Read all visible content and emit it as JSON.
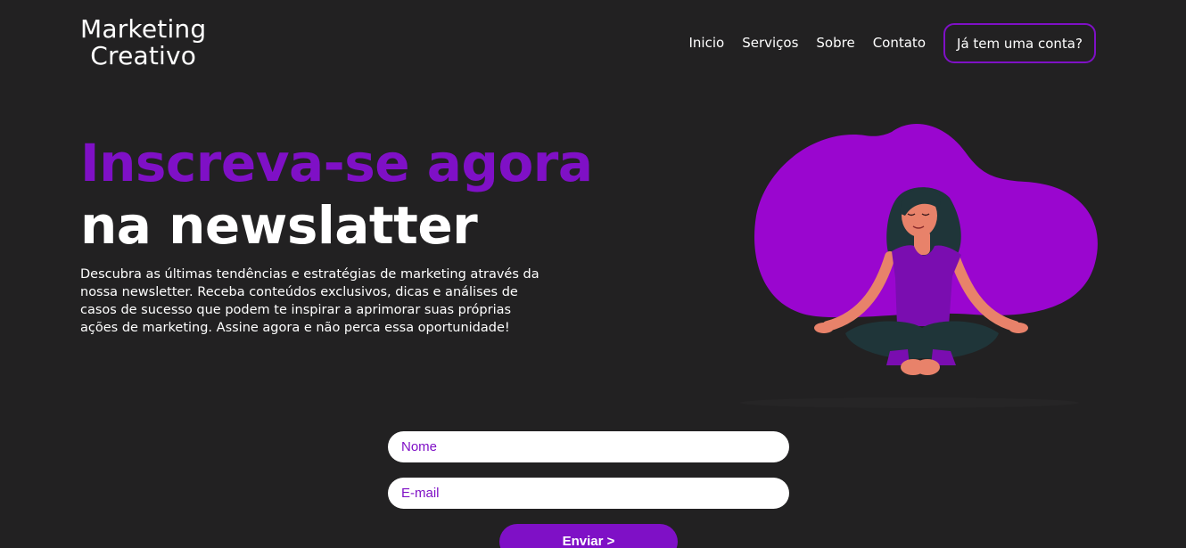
{
  "header": {
    "logo_line1": "Marketing",
    "logo_line2": "Creativo",
    "nav": {
      "home": "Inicio",
      "services": "Serviços",
      "about": "Sobre",
      "contact": "Contato"
    },
    "login_label": "Já tem uma conta?"
  },
  "hero": {
    "headline_accent": "Inscreva-se agora",
    "headline_main": "na newslatter",
    "description": "Descubra as últimas tendências e estratégias de marketing através da nossa newsletter. Receba conteúdos exclusivos, dicas e análises de casos de sucesso que podem te inspirar a aprimorar suas próprias ações de marketing. Assine agora e não perca essa oportunidade!"
  },
  "illustration": {
    "icon": "meditating-woman-illustration"
  },
  "form": {
    "name_placeholder": "Nome",
    "email_placeholder": "E-mail",
    "submit_label": "Enviar >"
  },
  "colors": {
    "background": "#222122",
    "accent": "#7f10c6",
    "blob": "#9a06cf",
    "text": "#ffffff"
  }
}
